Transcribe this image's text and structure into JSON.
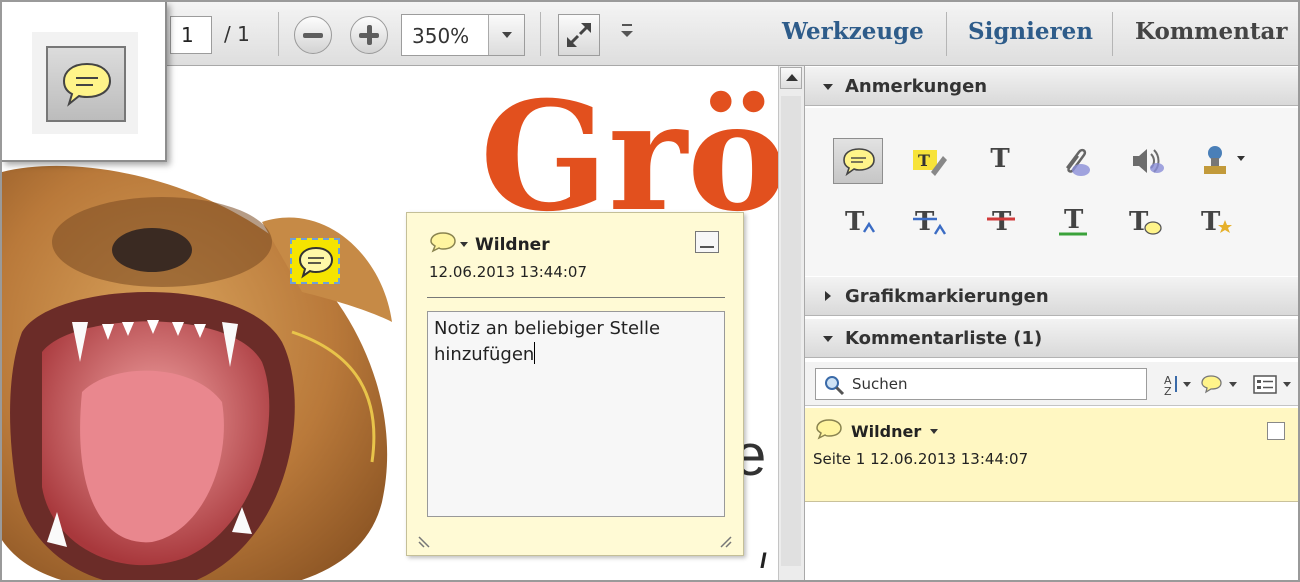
{
  "toolbar": {
    "page_current": "1",
    "page_total": "/  1",
    "zoom": "350%",
    "nav": [
      "Werkzeuge",
      "Signieren",
      "Kommentar"
    ],
    "nav_color": "#2e5c8a",
    "icons": [
      "zoom-out-icon",
      "zoom-in-icon",
      "full-screen-icon",
      "more-tools-icon"
    ]
  },
  "document": {
    "heading_fragment": "Grö",
    "heading_color": "#e2501e",
    "body_fragment": "e",
    "footer_fragment": "I"
  },
  "popup_note": {
    "author": "Wildner",
    "date": "12.06.2013 13:44:07",
    "text_line1": "Notiz an beliebiger Stelle",
    "text_line2": "hinzufügen"
  },
  "panel": {
    "sections": {
      "annotations": "Anmerkungen",
      "graphics": "Grafikmarkierungen",
      "comment_list": "Kommentarliste (1)"
    },
    "tool_icons": [
      "sticky-note-icon",
      "highlight-text-icon",
      "add-text-icon",
      "attach-file-icon",
      "record-audio-icon",
      "stamp-icon",
      "insert-text-icon",
      "replace-text-icon",
      "strikethrough-icon",
      "underline-icon",
      "text-comment-icon",
      "text-correction-icon"
    ],
    "search_placeholder": "Suchen",
    "comment": {
      "author": "Wildner",
      "meta": "Seite 1  12.06.2013 13:44:07"
    }
  },
  "colors": {
    "note_yellow": "#f5e400",
    "comment_bg": "#fff7c2",
    "popup_bg": "#fffad5"
  }
}
